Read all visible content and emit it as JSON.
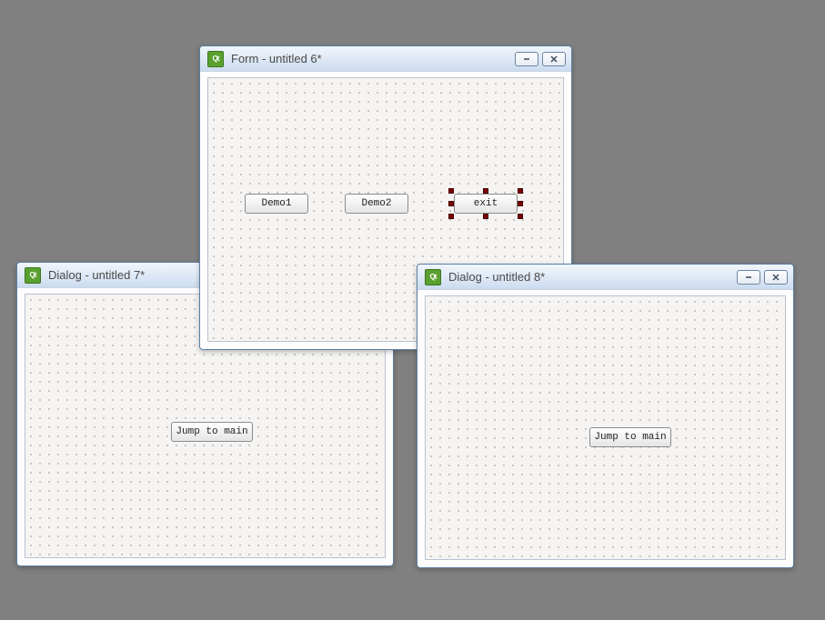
{
  "windows": {
    "form": {
      "title": "Form - untitled 6*",
      "buttons": {
        "demo1": "Demo1",
        "demo2": "Demo2",
        "exit": "exit"
      }
    },
    "dialog7": {
      "title": "Dialog - untitled 7*",
      "buttons": {
        "jump": "Jump to main"
      }
    },
    "dialog8": {
      "title": "Dialog - untitled 8*",
      "buttons": {
        "jump": "Jump to main"
      }
    }
  },
  "icons": {
    "minimize_glyph": "—",
    "close_glyph": "✕"
  }
}
